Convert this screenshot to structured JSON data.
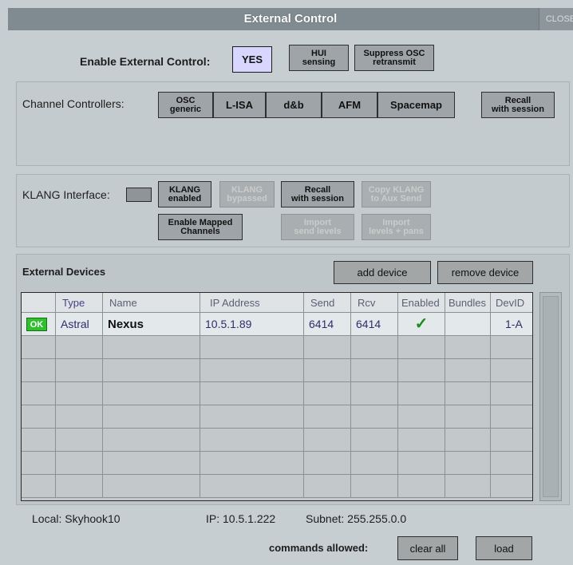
{
  "title": "External Control",
  "close_label": "CLOSE",
  "enable": {
    "label": "Enable External Control:",
    "yes": "YES",
    "hui": "HUI\nsensing",
    "suppress": "Suppress OSC\nretransmit"
  },
  "channel_controllers": {
    "label": "Channel Controllers:",
    "buttons": [
      "OSC\ngeneric",
      "L-ISA",
      "d&b",
      "AFM",
      "Spacemap"
    ],
    "recall": "Recall\nwith session"
  },
  "klang": {
    "label": "KLANG Interface:",
    "enabled": "KLANG\nenabled",
    "bypassed": "KLANG\nbypassed",
    "recall": "Recall\nwith session",
    "copy": "Copy KLANG\nto Aux Send",
    "enable_mapped": "Enable Mapped\nChannels",
    "import_send": "Import\nsend levels",
    "import_pans": "Import\nlevels + pans"
  },
  "external_devices": {
    "title": "External Devices",
    "add": "add device",
    "remove": "remove device",
    "columns": [
      "",
      "Type",
      "Name",
      "IP Address",
      "Send",
      "Rcv",
      "Enabled",
      "Bundles",
      "DevID"
    ],
    "rows": [
      {
        "status": "OK",
        "type": "Astral",
        "name": "Nexus",
        "ip": "10.5.1.89",
        "send": "6414",
        "rcv": "6414",
        "enabled": "✓",
        "bundles": "",
        "devid": "1-A"
      }
    ]
  },
  "footer": {
    "local": "Local:   Skyhook10",
    "ip": "IP: 10.5.1.222",
    "subnet": "Subnet: 255.255.0.0",
    "commands": "commands allowed:",
    "clear": "clear all",
    "load": "load"
  },
  "colors": {
    "ok_green": "#2fbf2f",
    "check_green": "#1c8a1c",
    "yes_bg": "#d8d5ff"
  }
}
